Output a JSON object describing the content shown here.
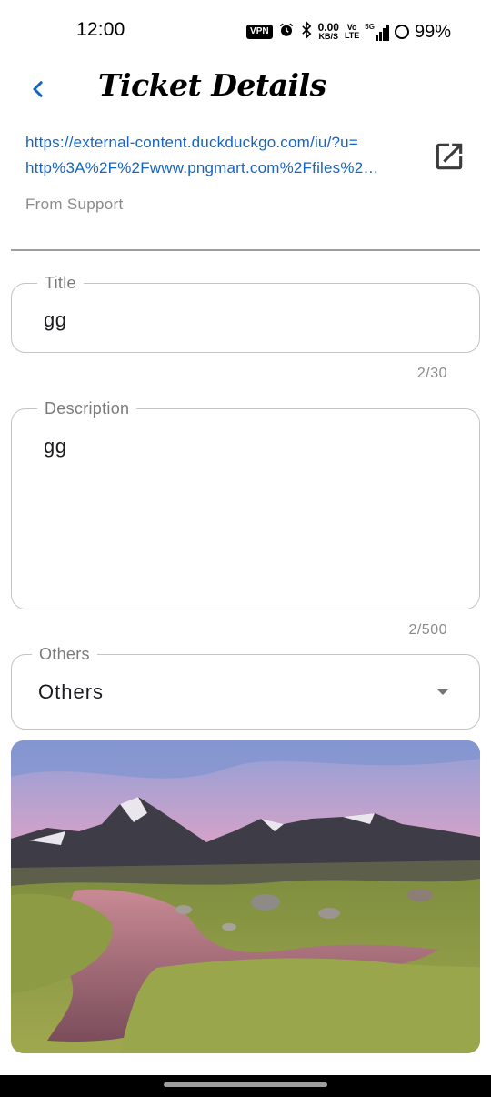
{
  "status_bar": {
    "time": "12:00",
    "vpn": "VPN",
    "speed_value": "0.00",
    "speed_unit": "KB/S",
    "volte_top": "Vo",
    "volte_bottom": "LTE",
    "network": "5G",
    "battery": "99%",
    "icons": [
      "alarm-icon",
      "bluetooth-icon",
      "signal-icon",
      "battery-icon"
    ]
  },
  "app_bar": {
    "title": "Ticket Details",
    "back_icon": "chevron-left-icon"
  },
  "attachment": {
    "link_line1": "https://external-content.duckduckgo.com/iu/?u=",
    "link_line2": "http%3A%2F%2Fwww.pngmart.com%2Ffiles%2…",
    "source": "From Support",
    "open_icon": "open-in-new-icon"
  },
  "form": {
    "title": {
      "label": "Title",
      "value": "gg",
      "counter": "2/30"
    },
    "description": {
      "label": "Description",
      "value": "gg",
      "counter": "2/500"
    },
    "category": {
      "label": "Others",
      "value": "Others"
    }
  },
  "colors": {
    "accent": "#1565c0",
    "link": "#1565c0",
    "outline": "#c4c4c4",
    "hint": "#8a8a8a"
  }
}
